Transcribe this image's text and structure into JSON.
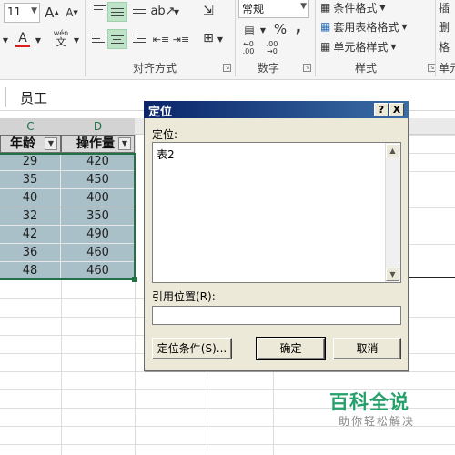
{
  "ribbon": {
    "font_size": "11",
    "font_grow_label": "A",
    "font_shrink_label": "A",
    "font_color_label": "A",
    "phonetic_label": "wén",
    "phonetic_sub": "文",
    "alignment_group_label": "对齐方式",
    "number_format_value": "常规",
    "percent_label": "%",
    "comma_label": ",",
    "increase_decimal_label": "←0 .00",
    "decrease_decimal_label": ".00 →0",
    "number_group_label": "数字",
    "conditional_format_label": "条件格式",
    "table_format_label": "套用表格格式",
    "cell_style_label": "单元格样式",
    "styles_group_label": "样式",
    "cells_insert_label": "插",
    "cells_delete_label": "删",
    "cells_format_label": "格",
    "cells_group_label": "单元"
  },
  "formula_bar": {
    "value": "员工"
  },
  "sheet": {
    "columns": [
      "C",
      "D"
    ],
    "headers": [
      "年龄",
      "操作量"
    ],
    "rows": [
      [
        "29",
        "420"
      ],
      [
        "35",
        "450"
      ],
      [
        "40",
        "400"
      ],
      [
        "32",
        "350"
      ],
      [
        "42",
        "490"
      ],
      [
        "36",
        "460"
      ],
      [
        "48",
        "460"
      ]
    ]
  },
  "dialog": {
    "title": "定位",
    "help_label": "?",
    "close_label": "X",
    "goto_label": "定位:",
    "goto_items": [
      "表2"
    ],
    "reference_label": "引用位置(R):",
    "reference_value": "",
    "special_button": "定位条件(S)...",
    "ok_button": "确定",
    "cancel_button": "取消"
  },
  "watermark": {
    "title": "百科全说",
    "subtitle": "助你轻松解决"
  }
}
